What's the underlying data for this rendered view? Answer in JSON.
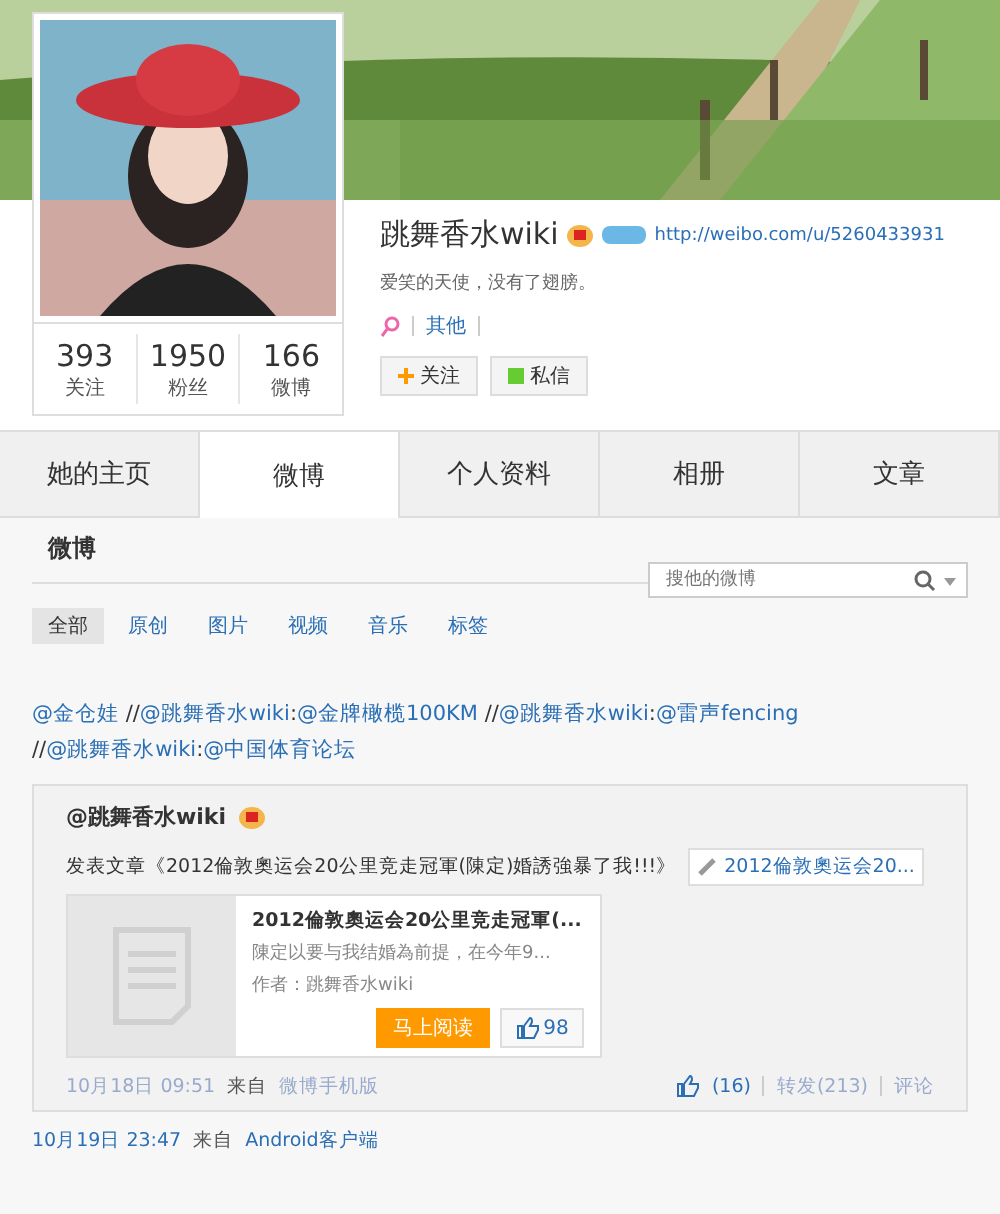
{
  "profile": {
    "name": "跳舞香水wiki",
    "url": "http://weibo.com/u/5260433931",
    "bio": "爱笑的天使，没有了翅膀。",
    "more": "其他",
    "stats": [
      {
        "value": "393",
        "label": "关注"
      },
      {
        "value": "1950",
        "label": "粉丝"
      },
      {
        "value": "166",
        "label": "微博"
      }
    ],
    "buttons": [
      {
        "kind": "follow",
        "label": "关注"
      },
      {
        "kind": "message",
        "label": "私信"
      }
    ]
  },
  "tabs": [
    {
      "label": "她的主页",
      "selected": false
    },
    {
      "label": "微博",
      "selected": true
    },
    {
      "label": "个人资料",
      "selected": false
    },
    {
      "label": "相册",
      "selected": false
    },
    {
      "label": "文章",
      "selected": false
    }
  ],
  "section": {
    "title": "微博",
    "search": {
      "placeholder": "搜他的微博"
    },
    "filters": [
      {
        "label": "全部",
        "selected": true
      },
      {
        "label": "原创",
        "selected": false
      },
      {
        "label": "图片",
        "selected": false
      },
      {
        "label": "视频",
        "selected": false
      },
      {
        "label": "音乐",
        "selected": false
      },
      {
        "label": "标签",
        "selected": false
      }
    ]
  },
  "posts": [
    {
      "segments": [
        {
          "kind": "mention",
          "text": "@金仓娃"
        },
        {
          "kind": "plain",
          "text": " //"
        },
        {
          "kind": "mention",
          "text": "@跳舞香水wiki"
        },
        {
          "kind": "plain",
          "text": ":"
        },
        {
          "kind": "mention",
          "text": "@金牌橄榄100KM"
        },
        {
          "kind": "plain",
          "text": " //"
        },
        {
          "kind": "mention",
          "text": "@跳舞香水wiki"
        },
        {
          "kind": "plain",
          "text": ":"
        },
        {
          "kind": "mention",
          "text": "@雷声fencing"
        },
        {
          "kind": "plain",
          "text": " //"
        },
        {
          "kind": "mention",
          "text": "@跳舞香水wiki"
        },
        {
          "kind": "plain",
          "text": ":"
        },
        {
          "kind": "mention",
          "text": "@中国体育论坛"
        }
      ],
      "repost": {
        "author": "@跳舞香水wiki",
        "text": "发表文章《2012倫敦奧运会20公里竞走冠軍(陳定)婚誘強暴了我!!!》",
        "link": "2012倫敦奧运会20...",
        "article": {
          "title": "2012倫敦奧运会20公里竞走冠軍(...",
          "excerpt": "陳定以要与我结婚為前提，在今年9...",
          "author": "作者：跳舞香水wiki",
          "read": "马上阅读",
          "likes": "98"
        },
        "time": "10月18日 09:51",
        "source_prefix": "来自",
        "source": "微博手机版",
        "actions": [
          "(16)",
          "转发(213)",
          "评论"
        ]
      },
      "time": "10月19日 23:47",
      "source_prefix": "来自",
      "source": "Android客户端"
    }
  ]
}
